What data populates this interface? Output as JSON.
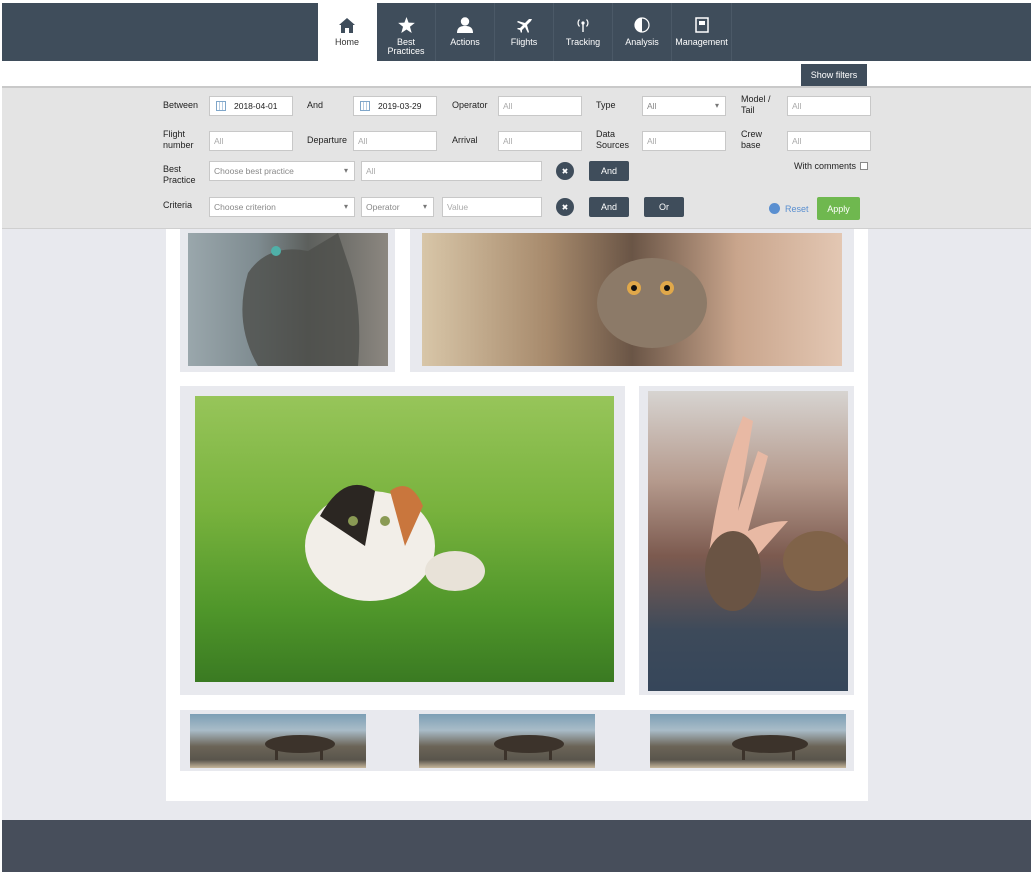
{
  "nav": {
    "items": [
      {
        "label": "Home",
        "icon": "home-icon"
      },
      {
        "label": "Best\nPractices",
        "icon": "star-icon"
      },
      {
        "label": "Actions",
        "icon": "user-icon"
      },
      {
        "label": "Flights",
        "icon": "plane-icon"
      },
      {
        "label": "Tracking",
        "icon": "antenna-icon"
      },
      {
        "label": "Analysis",
        "icon": "pie-chart-icon"
      },
      {
        "label": "Management",
        "icon": "document-icon"
      }
    ],
    "active": "Home"
  },
  "show_filters_label": "Show filters",
  "filters": {
    "between_label": "Between",
    "between_value": "2018-04-01",
    "and_label": "And",
    "and_value": "2019-03-29",
    "operator_label": "Operator",
    "operator_placeholder": "All",
    "type_label": "Type",
    "type_value": "All",
    "model_tail_label": "Model /\nTail",
    "model_tail_placeholder": "All",
    "flight_number_label": "Flight\nnumber",
    "flight_number_placeholder": "All",
    "departure_label": "Departure",
    "departure_placeholder": "All",
    "arrival_label": "Arrival",
    "arrival_placeholder": "All",
    "data_sources_label": "Data\nSources",
    "data_sources_placeholder": "All",
    "crew_base_label": "Crew\nbase",
    "crew_base_placeholder": "All",
    "with_comments_label": "With comments",
    "best_practice_label": "Best\nPractice",
    "best_practice_select": "Choose best practice",
    "best_practice_value": "All",
    "criteria_label": "Criteria",
    "criteria_select": "Choose criterion",
    "operator_select": "Operator",
    "value_placeholder": "Value",
    "and_button": "And",
    "or_button": "Or",
    "reset_label": "Reset",
    "apply_label": "Apply"
  },
  "colors": {
    "nav_bg": "#3f4d5b",
    "apply_green": "#6fb84f",
    "reset_blue": "#5a8fd0"
  }
}
